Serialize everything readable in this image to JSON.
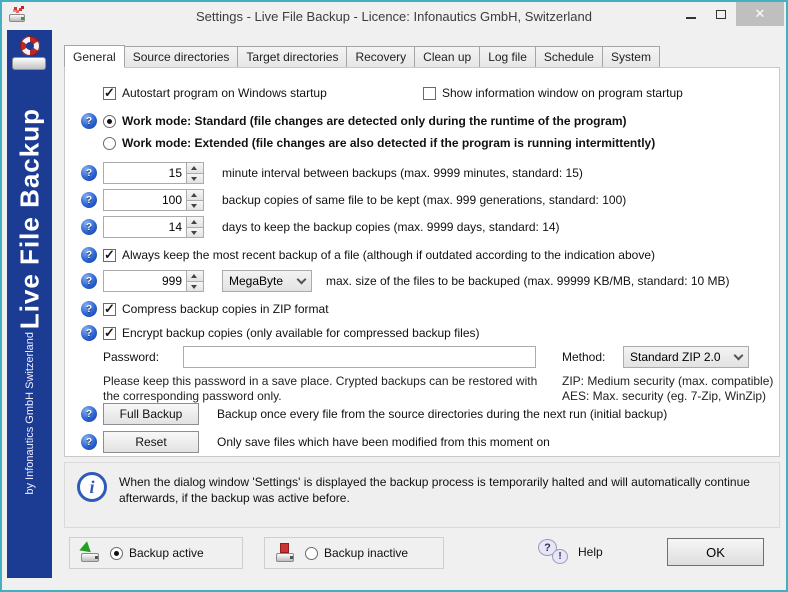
{
  "window": {
    "title": "Settings - Live File Backup - Licence: Infonautics GmbH, Switzerland",
    "close_glyph": "✕",
    "border_color": "#43b0c1"
  },
  "sidebar": {
    "brand_large": "Live File Backup",
    "brand_small": "by Infonautics GmbH Switzerland",
    "bg_color": "#1c3c94"
  },
  "tabs": [
    {
      "label": "General",
      "active": true
    },
    {
      "label": "Source directories",
      "active": false
    },
    {
      "label": "Target directories",
      "active": false
    },
    {
      "label": "Recovery",
      "active": false
    },
    {
      "label": "Clean up",
      "active": false
    },
    {
      "label": "Log file",
      "active": false
    },
    {
      "label": "Schedule",
      "active": false
    },
    {
      "label": "System",
      "active": false
    }
  ],
  "general": {
    "autostart": {
      "label": "Autostart program on Windows startup",
      "checked": true
    },
    "show_info_window": {
      "label": "Show information window on program startup",
      "checked": false
    },
    "work_mode_standard": {
      "label": "Work mode: Standard (file changes are detected only during the runtime of the program)",
      "selected": true
    },
    "work_mode_extended": {
      "label": "Work mode: Extended (file changes are also detected if the program is running intermittently)",
      "selected": false
    },
    "interval": {
      "value": "15",
      "label": "minute interval between backups (max. 9999 minutes, standard: 15)"
    },
    "copies": {
      "value": "100",
      "label": "backup copies of same file to be kept (max. 999 generations, standard: 100)"
    },
    "days": {
      "value": "14",
      "label": "days to keep the backup copies (max. 9999 days, standard: 14)"
    },
    "keep_recent": {
      "label": "Always keep the most recent backup of a file (although if outdated according to the indication above)",
      "checked": true
    },
    "max_size": {
      "value": "999",
      "unit": "MegaByte",
      "label": "max. size of the files to be backuped (max. 99999 KB/MB, standard: 10 MB)"
    },
    "compress": {
      "label": "Compress backup copies in ZIP format",
      "checked": true
    },
    "encrypt": {
      "label": "Encrypt backup copies (only available for compressed backup files)",
      "checked": true
    },
    "password": {
      "label": "Password:",
      "value": ""
    },
    "password_hint": "Please keep this password in a save place. Crypted backups can be restored with the corresponding password only.",
    "method": {
      "label": "Method:",
      "value": "Standard ZIP 2.0"
    },
    "method_hint_zip": "ZIP: Medium security (max. compatible)",
    "method_hint_aes": "AES: Max. security (eg. 7-Zip, WinZip)",
    "full_backup": {
      "button": "Full Backup",
      "label": "Backup once every file from the source directories during the next run (initial backup)"
    },
    "reset": {
      "button": "Reset",
      "label": "Only save files which have been modified from this moment on"
    }
  },
  "info_note": "When the dialog window 'Settings' is displayed the backup process is temporarily halted and will automatically continue afterwards, if the backup was active before.",
  "footer": {
    "backup_active": {
      "label": "Backup active",
      "selected": true
    },
    "backup_inactive": {
      "label": "Backup inactive",
      "selected": false
    },
    "help_label": "Help",
    "help_q": "?",
    "help_x": "!",
    "ok_label": "OK"
  }
}
